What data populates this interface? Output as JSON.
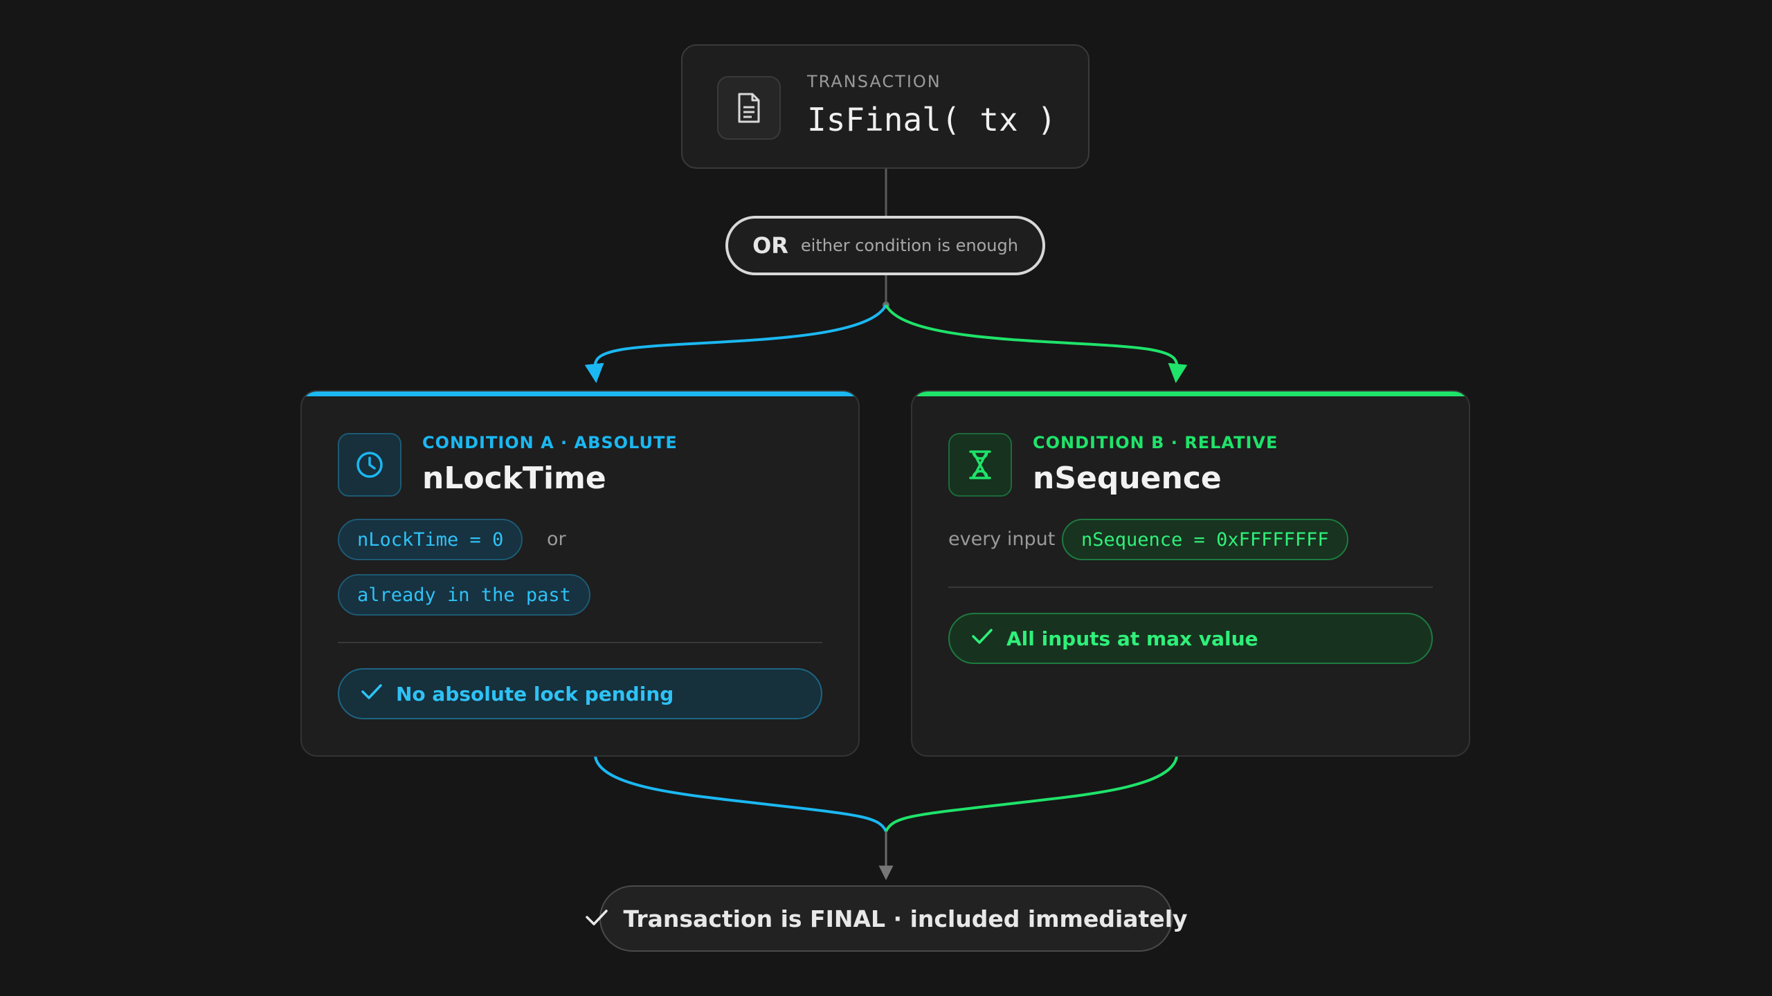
{
  "transaction": {
    "kicker": "TRANSACTION",
    "title": "IsFinal( tx )",
    "icon": "document-icon"
  },
  "or_gate": {
    "label": "OR",
    "note": "either condition is enough"
  },
  "condition_a": {
    "kicker": "CONDITION A · ABSOLUTE",
    "title": "nLockTime",
    "icon": "clock-icon",
    "chip_1": "nLockTime = 0",
    "joiner": "or",
    "chip_2": "already in the past",
    "result": "No absolute lock pending",
    "color": "#1bb8f2"
  },
  "condition_b": {
    "kicker": "CONDITION B · RELATIVE",
    "title": "nSequence",
    "icon": "hourglass-icon",
    "prefix": "every input",
    "chip_1": "nSequence = 0xFFFFFFFF",
    "result": "All inputs at max value",
    "color": "#1fe36a"
  },
  "final": {
    "text": "Transaction is FINAL · included immediately",
    "icon": "check-icon"
  }
}
